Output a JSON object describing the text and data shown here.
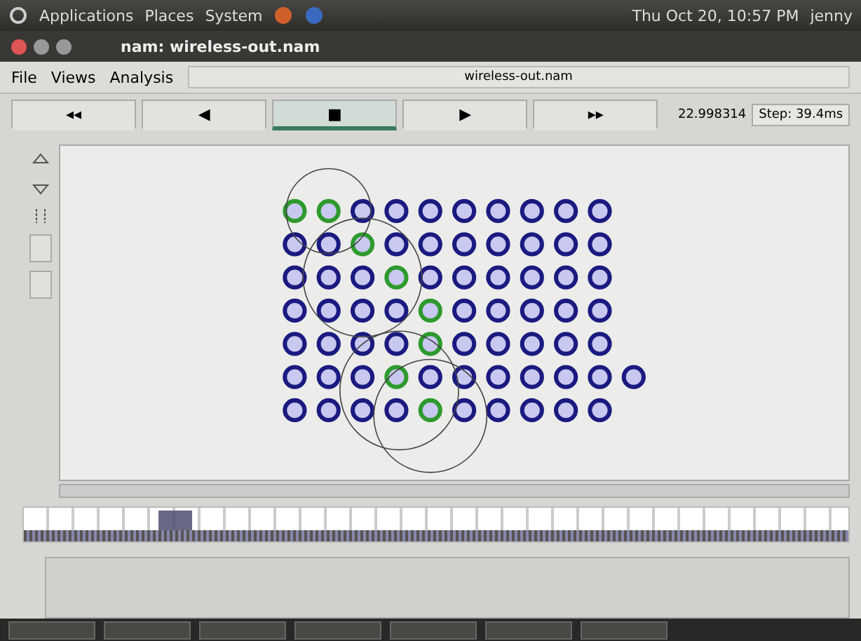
{
  "top_panel": {
    "menus": [
      "Applications",
      "Places",
      "System"
    ],
    "clock": "Thu Oct 20, 10:57 PM",
    "user": "jenny"
  },
  "window": {
    "title": "nam: wireless-out.nam"
  },
  "menu": [
    "File",
    "Views",
    "Analysis"
  ],
  "file_name": "wireless-out.nam",
  "controls": [
    {
      "label": "◂◂",
      "selected": false
    },
    {
      "label": "◀",
      "selected": false
    },
    {
      "label": "■",
      "selected": true
    },
    {
      "label": "▶",
      "selected": false
    },
    {
      "label": "▸▸",
      "selected": false
    }
  ],
  "time": "22.998314",
  "step": "Step: 39.4ms",
  "nodes": [
    [
      {
        "color": "#2e9a2e"
      },
      {
        "color": "#2e9a2e"
      },
      {
        "color": "#1a1a80"
      },
      {
        "color": "#1a1a80"
      },
      {
        "color": "#1a1a80"
      },
      {
        "color": "#1a1a80"
      },
      {
        "color": "#1a1a80"
      },
      {
        "color": "#1a1a80"
      },
      {
        "color": "#1a1a80"
      },
      {
        "color": "#1a1a80"
      }
    ],
    [
      {
        "color": "#1a1a80"
      },
      {
        "color": "#1a1a80"
      },
      {
        "color": "#2e9a2e"
      },
      {
        "color": "#1a1a80"
      },
      {
        "color": "#1a1a80"
      },
      {
        "color": "#1a1a80"
      },
      {
        "color": "#1a1a80"
      },
      {
        "color": "#1a1a80"
      },
      {
        "color": "#1a1a80"
      },
      {
        "color": "#1a1a80"
      }
    ],
    [
      {
        "color": "#1a1a80"
      },
      {
        "color": "#1a1a80"
      },
      {
        "color": "#1a1a80"
      },
      {
        "color": "#2e9a2e"
      },
      {
        "color": "#1a1a80"
      },
      {
        "color": "#1a1a80"
      },
      {
        "color": "#1a1a80"
      },
      {
        "color": "#1a1a80"
      },
      {
        "color": "#1a1a80"
      },
      {
        "color": "#1a1a80"
      }
    ],
    [
      {
        "color": "#1a1a80"
      },
      {
        "color": "#1a1a80"
      },
      {
        "color": "#1a1a80"
      },
      {
        "color": "#1a1a80"
      },
      {
        "color": "#2e9a2e"
      },
      {
        "color": "#1a1a80"
      },
      {
        "color": "#1a1a80"
      },
      {
        "color": "#1a1a80"
      },
      {
        "color": "#1a1a80"
      },
      {
        "color": "#1a1a80"
      }
    ],
    [
      {
        "color": "#1a1a80"
      },
      {
        "color": "#1a1a80"
      },
      {
        "color": "#1a1a80"
      },
      {
        "color": "#1a1a80"
      },
      {
        "color": "#2e9a2e"
      },
      {
        "color": "#1a1a80"
      },
      {
        "color": "#1a1a80"
      },
      {
        "color": "#1a1a80"
      },
      {
        "color": "#1a1a80"
      },
      {
        "color": "#1a1a80"
      }
    ],
    [
      {
        "color": "#1a1a80"
      },
      {
        "color": "#1a1a80"
      },
      {
        "color": "#1a1a80"
      },
      {
        "color": "#2e9a2e"
      },
      {
        "color": "#1a1a80"
      },
      {
        "color": "#1a1a80"
      },
      {
        "color": "#1a1a80"
      },
      {
        "color": "#1a1a80"
      },
      {
        "color": "#1a1a80"
      },
      {
        "color": "#1a1a80"
      },
      {
        "color": "#1a1a80"
      }
    ],
    [
      {
        "color": "#1a1a80"
      },
      {
        "color": "#1a1a80"
      },
      {
        "color": "#1a1a80"
      },
      {
        "color": "#1a1a80"
      },
      {
        "color": "#2e9a2e"
      },
      {
        "color": "#1a1a80"
      },
      {
        "color": "#1a1a80"
      },
      {
        "color": "#1a1a80"
      },
      {
        "color": "#1a1a80"
      },
      {
        "color": "#1a1a80"
      }
    ]
  ]
}
